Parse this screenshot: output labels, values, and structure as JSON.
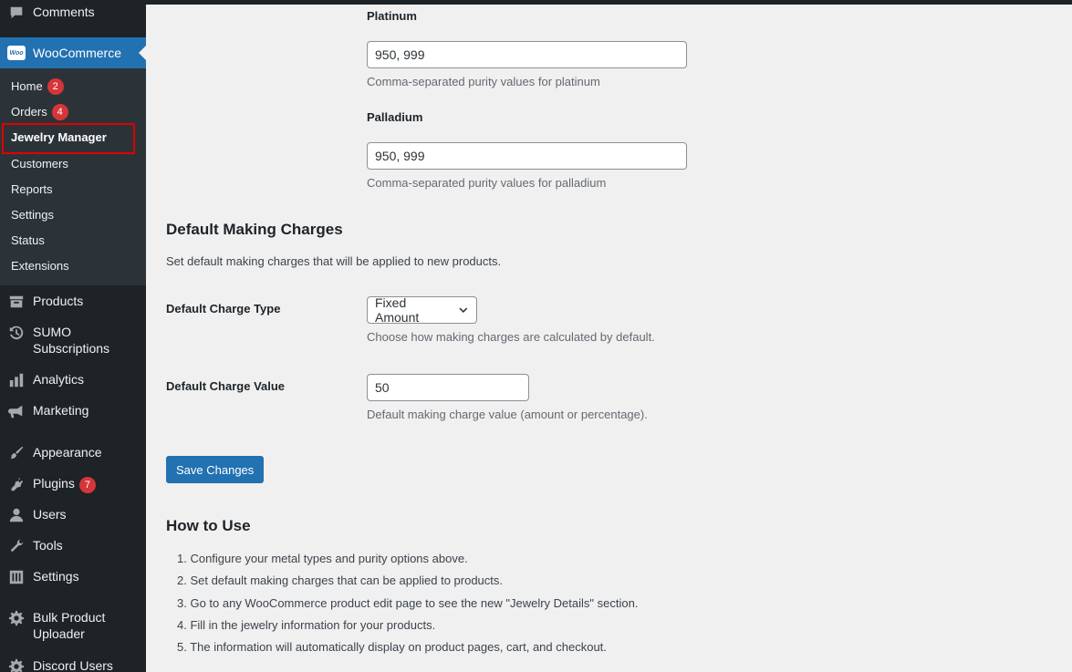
{
  "sidebar": {
    "top_items": [
      {
        "label": "Comments",
        "icon": "comment-icon"
      }
    ],
    "woocommerce": {
      "label": "WooCommerce",
      "logo_text": "Woo"
    },
    "submenu": [
      {
        "label": "Home",
        "badge": "2"
      },
      {
        "label": "Orders",
        "badge": "4"
      },
      {
        "label": "Jewelry Manager",
        "current": true
      },
      {
        "label": "Customers"
      },
      {
        "label": "Reports"
      },
      {
        "label": "Settings"
      },
      {
        "label": "Status"
      },
      {
        "label": "Extensions"
      }
    ],
    "items": [
      {
        "label": "Products",
        "icon": "archive-icon"
      },
      {
        "label": "SUMO Subscriptions",
        "icon": "history-icon"
      },
      {
        "label": "Analytics",
        "icon": "bar-chart-icon"
      },
      {
        "label": "Marketing",
        "icon": "megaphone-icon"
      },
      {
        "label": "Appearance",
        "icon": "paintbrush-icon"
      },
      {
        "label": "Plugins",
        "icon": "plugin-icon",
        "badge": "7"
      },
      {
        "label": "Users",
        "icon": "user-icon"
      },
      {
        "label": "Tools",
        "icon": "wrench-icon"
      },
      {
        "label": "Settings",
        "icon": "sliders-icon"
      },
      {
        "label": "Bulk Product Uploader",
        "icon": "gear-icon"
      },
      {
        "label": "Discord Users",
        "icon": "gear-icon"
      }
    ]
  },
  "purity": {
    "platinum": {
      "label": "Platinum",
      "value": "950, 999",
      "desc": "Comma-separated purity values for platinum"
    },
    "palladium": {
      "label": "Palladium",
      "value": "950, 999",
      "desc": "Comma-separated purity values for palladium"
    }
  },
  "making_charges": {
    "title": "Default Making Charges",
    "desc": "Set default making charges that will be applied to new products.",
    "charge_type": {
      "label": "Default Charge Type",
      "value": "Fixed Amount",
      "desc": "Choose how making charges are calculated by default."
    },
    "charge_value": {
      "label": "Default Charge Value",
      "value": "50",
      "desc": "Default making charge value (amount or percentage)."
    }
  },
  "save_label": "Save Changes",
  "how_to": {
    "title": "How to Use",
    "steps": [
      "1. Configure your metal types and purity options above.",
      "2. Set default making charges that can be applied to products.",
      "3. Go to any WooCommerce product edit page to see the new \"Jewelry Details\" section.",
      "4. Fill in the jewelry information for your products.",
      "5. The information will automatically display on product pages, cart, and checkout."
    ]
  },
  "colors": {
    "sidebar_bg": "#1d2327",
    "submenu_bg": "#2c3338",
    "accent": "#2271b1",
    "badge": "#d63638",
    "highlight": "#e00000"
  }
}
